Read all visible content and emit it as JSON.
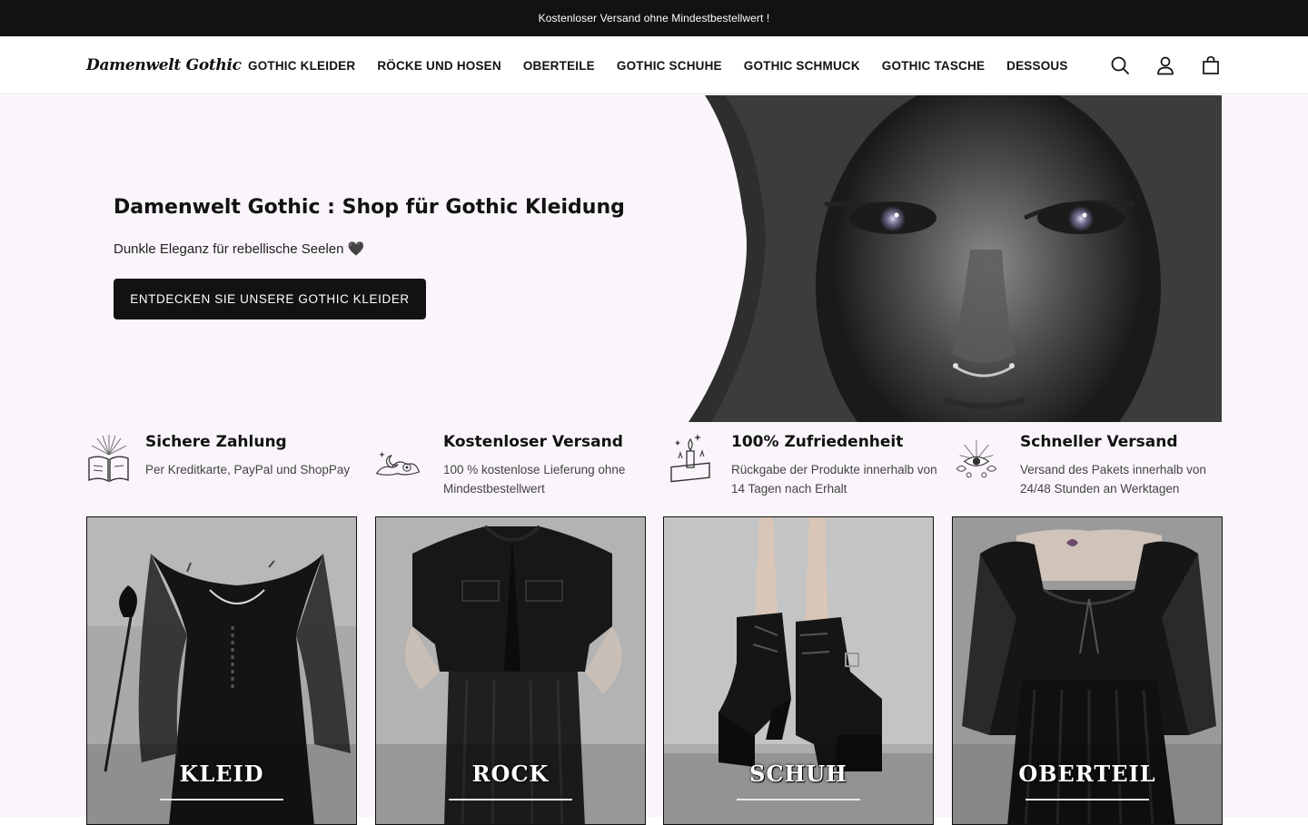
{
  "announcement": "Kostenloser Versand ohne Mindestbestellwert !",
  "header": {
    "logo": "Damenwelt Gothic",
    "nav": [
      "GOTHIC KLEIDER",
      "RÖCKE UND HOSEN",
      "OBERTEILE",
      "GOTHIC SCHUHE",
      "GOTHIC SCHMUCK",
      "GOTHIC TASCHE",
      "DESSOUS"
    ],
    "icons": [
      "search-icon",
      "account-icon",
      "cart-icon"
    ]
  },
  "hero": {
    "title": "Damenwelt Gothic : Shop für Gothic Kleidung",
    "subtitle": "Dunkle Eleganz für rebellische Seelen 🖤",
    "button": "ENTDECKEN SIE UNSERE GOTHIC KLEIDER"
  },
  "features": [
    {
      "icon": "book-icon",
      "title": "Sichere Zahlung",
      "text": "Per Kreditkarte, PayPal und ShopPay"
    },
    {
      "icon": "moon-icon",
      "title": "Kostenloser Versand",
      "text": "100 % kostenlose Lieferung ohne Mindestbestellwert"
    },
    {
      "icon": "candle-icon",
      "title": "100% Zufriedenheit",
      "text": "Rückgabe der Produkte innerhalb von 14 Tagen nach Erhalt"
    },
    {
      "icon": "eye-icon",
      "title": "Schneller Versand",
      "text": "Versand des Pakets innerhalb von 24/48 Stunden an Werktagen"
    }
  ],
  "categories": [
    {
      "label": "KLEID"
    },
    {
      "label": "ROCK"
    },
    {
      "label": "SCHUH"
    },
    {
      "label": "OBERTEIL"
    }
  ],
  "colors": {
    "dark": "#121212",
    "background": "#f9f5fa",
    "white": "#ffffff"
  }
}
